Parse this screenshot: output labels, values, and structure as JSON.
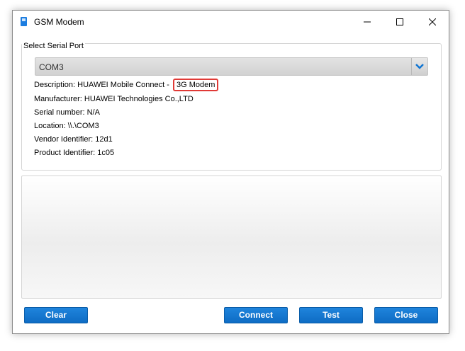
{
  "window": {
    "title": "GSM Modem"
  },
  "serial_port": {
    "group_label": "Select Serial Port",
    "selected": "COM3",
    "description_label": "Description: HUAWEI Mobile Connect - ",
    "description_highlight": "3G Modem",
    "manufacturer": "Manufacturer: HUAWEI Technologies Co.,LTD",
    "serial_number": "Serial number: N/A",
    "location": "Location: \\\\.\\COM3",
    "vendor_id": "Vendor Identifier: 12d1",
    "product_id": "Product Identifier: 1c05"
  },
  "buttons": {
    "clear": "Clear",
    "connect": "Connect",
    "test": "Test",
    "close": "Close"
  },
  "icons": {
    "app": "sim-card-icon",
    "minimize": "minimize-icon",
    "maximize": "maximize-icon",
    "close": "close-icon",
    "dropdown": "chevron-down-icon"
  },
  "colors": {
    "accent": "#1175d3",
    "highlight": "#e03a36"
  }
}
